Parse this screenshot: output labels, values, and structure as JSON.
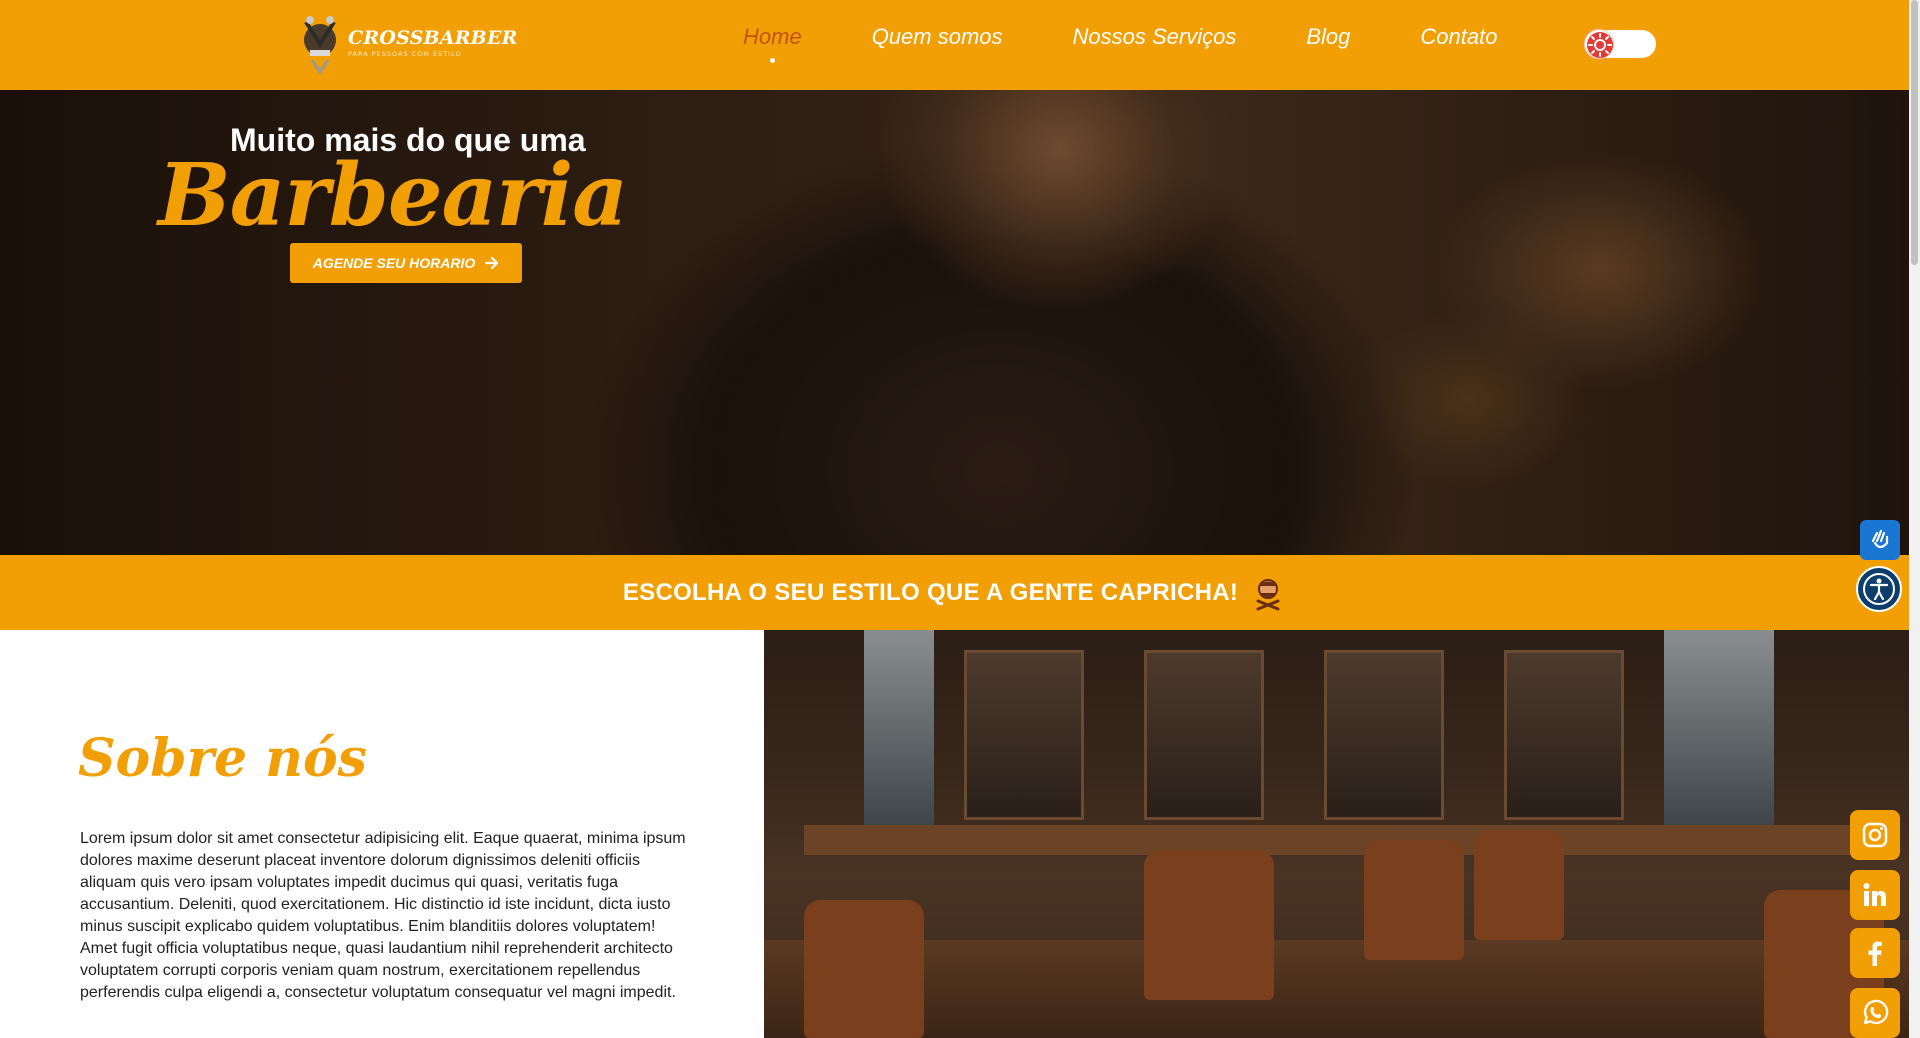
{
  "brand": {
    "name": "CROSSBARBER",
    "tagline": "PARA PESSOAS COM ESTILO"
  },
  "nav": {
    "items": [
      {
        "label": "Home",
        "active": true
      },
      {
        "label": "Quem somos",
        "active": false
      },
      {
        "label": "Nossos Serviços",
        "active": false
      },
      {
        "label": "Blog",
        "active": false
      },
      {
        "label": "Contato",
        "active": false
      }
    ],
    "theme_toggle_icon": "sun-icon"
  },
  "hero": {
    "title_top": "Muito mais do que uma",
    "title_big": "Barbearia",
    "cta_label": "AGENDE SEU HORARIO",
    "cta_icon": "arrow-right-icon"
  },
  "banner": {
    "text": "ESCOLHA O SEU ESTILO QUE A GENTE CAPRICHA!",
    "icon": "barber-icon"
  },
  "about": {
    "title": "Sobre nós",
    "text": "Lorem ipsum dolor sit amet consectetur adipisicing elit. Eaque quaerat, minima ipsum dolores maxime deserunt placeat inventore dolorum dignissimos deleniti officiis aliquam quis vero ipsam voluptates impedit ducimus qui quasi, veritatis fuga accusantium. Deleniti, quod exercitationem. Hic distinctio id iste incidunt, dicta iusto minus suscipit explicabo quidem voluptatibus. Enim blanditiis dolores voluptatem! Amet fugit officia voluptatibus neque, quasi laudantium nihil reprehenderit architecto voluptatem corrupti corporis veniam quam nostrum, exercitationem repellendus perferendis culpa eligendi a, consectetur voluptatum consequatur vel magni impedit."
  },
  "social": [
    {
      "name": "instagram-icon",
      "glyph": "◎"
    },
    {
      "name": "linkedin-icon",
      "glyph": "in"
    },
    {
      "name": "facebook-icon",
      "glyph": "f"
    },
    {
      "name": "whatsapp-icon",
      "glyph": "✆"
    }
  ],
  "colors": {
    "accent": "#f29f05",
    "nav_active": "#c0540d",
    "a11y_blue": "#1976d2"
  }
}
